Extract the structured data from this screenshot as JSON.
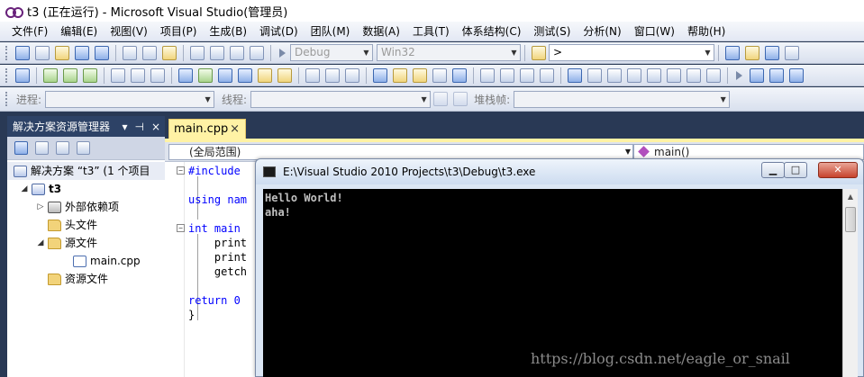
{
  "window": {
    "title": "t3 (正在运行) - Microsoft Visual Studio(管理员)"
  },
  "menu": [
    "文件(F)",
    "编辑(E)",
    "视图(V)",
    "项目(P)",
    "生成(B)",
    "调试(D)",
    "团队(M)",
    "数据(A)",
    "工具(T)",
    "体系结构(C)",
    "测试(S)",
    "分析(N)",
    "窗口(W)",
    "帮助(H)"
  ],
  "toolbar": {
    "config": "Debug",
    "platform": "Win32",
    "find_value": ">"
  },
  "debug_location": {
    "process_label": "进程:",
    "thread_label": "线程:",
    "stack_label": "堆栈帧:"
  },
  "solution_explorer": {
    "title": "解决方案资源管理器",
    "pin": "⊣",
    "close": "×",
    "items": [
      {
        "label": "解决方案 “t3” (1 个项目"
      },
      {
        "label": "t3"
      },
      {
        "label": "外部依赖项"
      },
      {
        "label": "头文件"
      },
      {
        "label": "源文件"
      },
      {
        "label": "main.cpp"
      },
      {
        "label": "资源文件"
      }
    ]
  },
  "editor": {
    "tab": "main.cpp",
    "tab_close": "×",
    "scope": "(全局范围)",
    "member": "main()",
    "lines": [
      "#include",
      "",
      "using nam",
      "",
      "int main",
      "    print",
      "    print",
      "    getch",
      "",
      "return 0",
      "}"
    ]
  },
  "console": {
    "title": "E:\\Visual Studio 2010 Projects\\t3\\Debug\\t3.exe",
    "output": [
      "Hello World!",
      "aha!"
    ],
    "min_glyph": "▁",
    "max_glyph": "□",
    "close_glyph": "✕"
  },
  "watermark": "https://blog.csdn.net/eagle_or_snail"
}
